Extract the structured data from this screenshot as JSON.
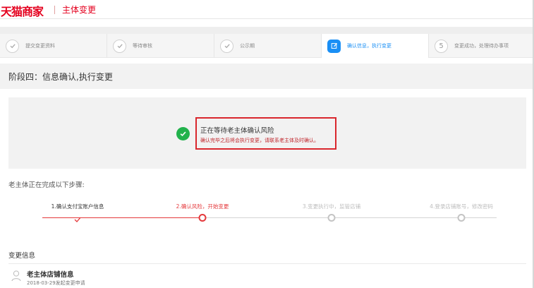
{
  "header": {
    "logo_text": "天猫商家",
    "page_name": "主体变更"
  },
  "steps": [
    {
      "label": "提交变更资料",
      "state": "done",
      "icon": "check-icon"
    },
    {
      "label": "等待审核",
      "state": "done",
      "icon": "check-icon"
    },
    {
      "label": "公示期",
      "state": "done",
      "icon": "check-icon"
    },
    {
      "label": "确认信息，执行变更",
      "state": "active",
      "icon": "edit-icon"
    },
    {
      "label": "变更成功，处理待办事项",
      "state": "pending",
      "number": "5"
    }
  ],
  "phase": {
    "title": "阶段四：信息确认,执行变更"
  },
  "status": {
    "title": "正在等待老主体确认风险",
    "description": "确认完毕之后将会执行变更，请联系老主体及时确认。"
  },
  "old_owner_section": {
    "label": "老主体正在完成以下步骤:",
    "steps": [
      {
        "label": "1.确认支付宝账户信息",
        "state": "done"
      },
      {
        "label": "2.确认风险，开始变更",
        "state": "current"
      },
      {
        "label": "3.变更执行中，监管店铺",
        "state": "pending"
      },
      {
        "label": "4.登录店铺账号，修改密码",
        "state": "pending"
      }
    ]
  },
  "change_info": {
    "label": "变更信息",
    "store_title": "老主体店铺信息",
    "store_date": "2018-03-29发起变更申请"
  },
  "colors": {
    "brand_red": "#e4001e",
    "accent_blue": "#1a8ff5",
    "success_green": "#22b24c",
    "highlight_red": "#d9272d",
    "progress_red": "#e4393c",
    "pending_gray": "#bdbdbd"
  }
}
